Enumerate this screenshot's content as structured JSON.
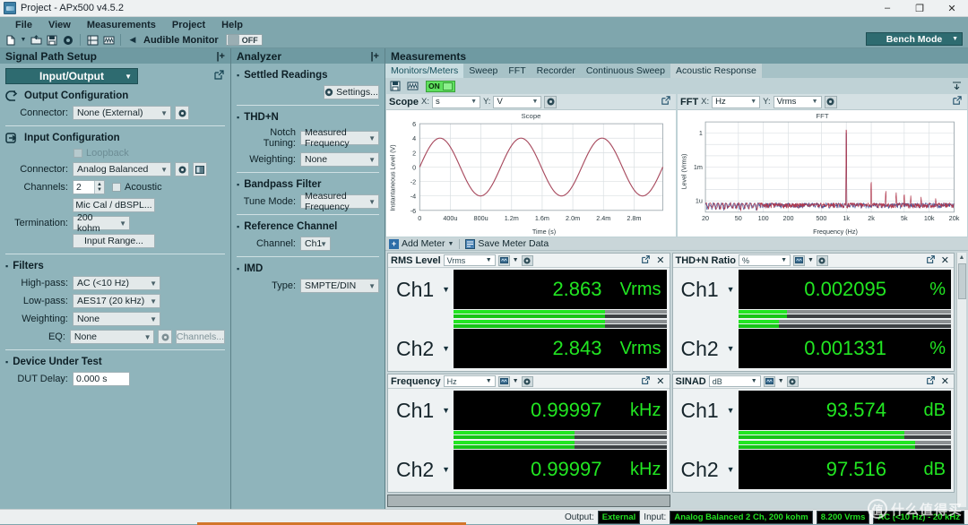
{
  "window": {
    "title": "Project - APx500 v4.5.2",
    "minimize": "–",
    "maximize": "❐",
    "close": "✕"
  },
  "menu": {
    "items": [
      "File",
      "View",
      "Measurements",
      "Project",
      "Help"
    ]
  },
  "toolbar": {
    "icons": [
      "new-document-icon",
      "open-folder-icon",
      "save-icon",
      "settings-gear-icon",
      "signal-path-icon",
      "waveform-icon"
    ],
    "audible_monitor_label": "Audible Monitor",
    "audible_monitor_state": "OFF",
    "bench_mode": "Bench Mode"
  },
  "signal_path": {
    "title": "Signal Path Setup",
    "expand_icon": "|+",
    "selector": "Input/Output",
    "output": {
      "heading": "Output Configuration",
      "connector_label": "Connector:",
      "connector_value": "None (External)"
    },
    "input": {
      "heading": "Input Configuration",
      "loopback_label": "Loopback",
      "connector_label": "Connector:",
      "connector_value": "Analog Balanced",
      "channels_label": "Channels:",
      "channels_value": "2",
      "acoustic_label": "Acoustic",
      "mic_cal_button": "Mic Cal / dBSPL...",
      "termination_label": "Termination:",
      "termination_value": "200 kohm",
      "input_range_button": "Input Range..."
    },
    "filters": {
      "heading": "Filters",
      "highpass_label": "High-pass:",
      "highpass_value": "AC (<10 Hz)",
      "lowpass_label": "Low-pass:",
      "lowpass_value": "AES17 (20 kHz)",
      "weighting_label": "Weighting:",
      "weighting_value": "None",
      "eq_label": "EQ:",
      "eq_value": "None",
      "channels_button": "Channels..."
    },
    "dut": {
      "heading": "Device Under Test",
      "delay_label": "DUT Delay:",
      "delay_value": "0.000 s"
    }
  },
  "analyzer": {
    "title": "Analyzer",
    "expand_icon": "|+",
    "settled": {
      "heading": "Settled Readings",
      "settings_button": "Settings..."
    },
    "thdn": {
      "heading": "THD+N",
      "notch_label": "Notch Tuning:",
      "notch_value": "Measured Frequency",
      "weighting_label": "Weighting:",
      "weighting_value": "None"
    },
    "bandpass": {
      "heading": "Bandpass Filter",
      "tune_label": "Tune Mode:",
      "tune_value": "Measured Frequency"
    },
    "reference": {
      "heading": "Reference Channel",
      "channel_label": "Channel:",
      "channel_value": "Ch1"
    },
    "imd": {
      "heading": "IMD",
      "type_label": "Type:",
      "type_value": "SMPTE/DIN"
    }
  },
  "measurements": {
    "title": "Measurements",
    "tabs": [
      {
        "label": "Monitors/Meters",
        "active": true
      },
      {
        "label": "Sweep",
        "active": false
      },
      {
        "label": "FFT",
        "active": false
      },
      {
        "label": "Recorder",
        "active": false
      },
      {
        "label": "Continuous Sweep",
        "active": false
      },
      {
        "label": "Acoustic Response",
        "active": false
      }
    ],
    "toolbar": {
      "on_state": "ON",
      "collapse_icon": "collapse-icon"
    },
    "meter_toolbar": {
      "add_meter": "Add Meter",
      "save_meter_data": "Save Meter Data"
    }
  },
  "graphs": {
    "scope": {
      "name": "Scope",
      "x_label": "X:",
      "x_unit": "s",
      "y_label": "Y:",
      "y_unit": "V",
      "popout_icon": "popout-icon",
      "gear_icon": "gear-icon"
    },
    "fft": {
      "name": "FFT",
      "x_label": "X:",
      "x_unit": "Hz",
      "y_label": "Y:",
      "y_unit": "Vrms",
      "popout_icon": "popout-icon",
      "gear_icon": "gear-icon"
    }
  },
  "chart_data": [
    {
      "type": "line",
      "title": "Scope",
      "xlabel": "Time (s)",
      "ylabel": "Instantaneous Level (V)",
      "xticks": [
        "0",
        "400u",
        "800u",
        "1.2m",
        "1.6m",
        "2.0m",
        "2.4m",
        "2.8m"
      ],
      "yticks": [
        "6",
        "4",
        "2",
        "0",
        "-2",
        "-4",
        "-6"
      ],
      "xlim": [
        0,
        0.003
      ],
      "ylim": [
        -6,
        6
      ],
      "grid": true,
      "legend": "none",
      "series": [
        {
          "name": "Ch1",
          "color": "#a84a5e",
          "waveform": "sine",
          "amplitude": 4.0,
          "frequency_hz": 1000,
          "phase_deg": 0
        }
      ]
    },
    {
      "type": "line",
      "title": "FFT",
      "xlabel": "Frequency (Hz)",
      "ylabel": "Level (Vrms)",
      "xticks": [
        "20",
        "50",
        "100",
        "200",
        "500",
        "1k",
        "2k",
        "5k",
        "10k",
        "20k"
      ],
      "yticks": [
        "1",
        "1m",
        "1u"
      ],
      "xlim": [
        20,
        20000
      ],
      "ylim": [
        1e-07,
        10
      ],
      "xscale": "log",
      "yscale": "log",
      "grid": true,
      "legend": "none",
      "series": [
        {
          "name": "Ch1",
          "color": "#b0394e",
          "noise_floor_vrms": 4e-07
        },
        {
          "name": "Ch2",
          "color": "#43579c",
          "noise_floor_vrms": 4e-07
        }
      ],
      "peaks": [
        {
          "freq_hz": 1000,
          "level_vrms": 2.86
        },
        {
          "freq_hz": 2000,
          "level_vrms": 6e-05
        },
        {
          "freq_hz": 3000,
          "level_vrms": 9e-06
        },
        {
          "freq_hz": 4000,
          "level_vrms": 6e-06
        },
        {
          "freq_hz": 5000,
          "level_vrms": 5e-06
        },
        {
          "freq_hz": 6000,
          "level_vrms": 3e-06
        },
        {
          "freq_hz": 8000,
          "level_vrms": 2.5e-06
        },
        {
          "freq_hz": 12000,
          "level_vrms": 2e-06
        }
      ]
    }
  ],
  "meters": [
    {
      "name": "RMS Level",
      "unit_select": "Vrms",
      "rows": [
        {
          "channel": "Ch1",
          "value": "2.863",
          "unit": "Vrms",
          "bar_pct": 71
        },
        {
          "channel": "Ch2",
          "value": "2.843",
          "unit": "Vrms",
          "bar_pct": 71
        }
      ]
    },
    {
      "name": "THD+N Ratio",
      "unit_select": "%",
      "rows": [
        {
          "channel": "Ch1",
          "value": "0.002095",
          "unit": "%",
          "bar_pct": 23
        },
        {
          "channel": "Ch2",
          "value": "0.001331",
          "unit": "%",
          "bar_pct": 19
        }
      ]
    },
    {
      "name": "Frequency",
      "unit_select": "Hz",
      "rows": [
        {
          "channel": "Ch1",
          "value": "0.99997",
          "unit": "kHz",
          "bar_pct": 57
        },
        {
          "channel": "Ch2",
          "value": "0.99997",
          "unit": "kHz",
          "bar_pct": 57
        }
      ]
    },
    {
      "name": "SINAD",
      "unit_select": "dB",
      "rows": [
        {
          "channel": "Ch1",
          "value": "93.574",
          "unit": "dB",
          "bar_pct": 78
        },
        {
          "channel": "Ch2",
          "value": "97.516",
          "unit": "dB",
          "bar_pct": 83
        }
      ]
    }
  ],
  "status": {
    "output_label": "Output:",
    "output_value": "External",
    "input_label": "Input:",
    "input_value": "Analog Balanced 2 Ch, 200 kohm",
    "range_value": "8.200 Vrms",
    "filter_value": "AC (<10 Hz) - 20 kHz"
  },
  "watermark": {
    "mark": "值",
    "text": "什么值得买"
  }
}
